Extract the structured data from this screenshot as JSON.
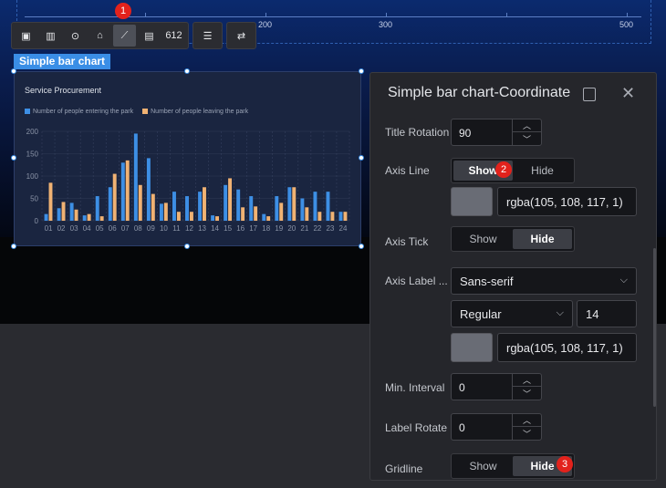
{
  "canvas": {
    "top_axis_labels": [
      "200",
      "300",
      "500"
    ]
  },
  "toolbar": {
    "tools": [
      {
        "name": "image-tool-icon",
        "glyph": "▣"
      },
      {
        "name": "bar-chart-tool-icon",
        "glyph": "▥"
      },
      {
        "name": "eye-tool-icon",
        "glyph": "⊙"
      },
      {
        "name": "map-tool-icon",
        "glyph": "⌂"
      },
      {
        "name": "line-chart-tool-icon",
        "glyph": "⟋"
      },
      {
        "name": "stacked-bar-tool-icon",
        "glyph": "▤"
      },
      {
        "name": "number-tool-icon",
        "glyph": "612"
      }
    ],
    "extra": [
      {
        "name": "database-icon",
        "glyph": "☰"
      },
      {
        "name": "link-icon",
        "glyph": "⇄"
      }
    ]
  },
  "badges": [
    "1",
    "2",
    "3"
  ],
  "widget": {
    "label": "Simple bar chart"
  },
  "chart_data": {
    "type": "bar",
    "title": "Service Procurement",
    "categories": [
      "01",
      "02",
      "03",
      "04",
      "05",
      "06",
      "07",
      "08",
      "09",
      "10",
      "11",
      "12",
      "13",
      "14",
      "15",
      "16",
      "17",
      "18",
      "19",
      "20",
      "21",
      "22",
      "23",
      "24"
    ],
    "series": [
      {
        "name": "Number of people entering the park",
        "color": "#3d8fe5",
        "values": [
          15,
          28,
          40,
          12,
          55,
          75,
          130,
          195,
          140,
          38,
          65,
          55,
          65,
          12,
          80,
          70,
          55,
          15,
          55,
          75,
          50,
          65,
          65,
          20
        ]
      },
      {
        "name": "Number of people leaving the park",
        "color": "#f0b273",
        "values": [
          85,
          42,
          25,
          15,
          10,
          105,
          135,
          80,
          60,
          40,
          20,
          20,
          75,
          10,
          95,
          30,
          32,
          10,
          40,
          75,
          30,
          20,
          20,
          20
        ]
      }
    ],
    "yticks": [
      "200",
      "150",
      "100",
      "50",
      "0"
    ],
    "ylim": [
      0,
      200
    ],
    "grid": true
  },
  "panel": {
    "title": "Simple bar chart-Coordinate",
    "title_rotation_label": "Title Rotation",
    "title_rotation_value": "90",
    "axis_line_label": "Axis Line",
    "axis_line_show": "Show",
    "axis_line_hide": "Hide",
    "axis_line_color": "rgba(105, 108, 117, 1)",
    "axis_tick_label": "Axis Tick",
    "axis_tick_show": "Show",
    "axis_tick_hide": "Hide",
    "axis_label_label": "Axis Label ...",
    "font_family": "Sans-serif",
    "font_weight": "Regular",
    "font_size": "14",
    "axis_label_color": "rgba(105, 108, 117, 1)",
    "min_interval_label": "Min. Interval",
    "min_interval_value": "0",
    "label_rotate_label": "Label Rotate",
    "label_rotate_value": "0",
    "gridline_label": "Gridline",
    "gridline_show": "Show",
    "gridline_hide": "Hide"
  }
}
